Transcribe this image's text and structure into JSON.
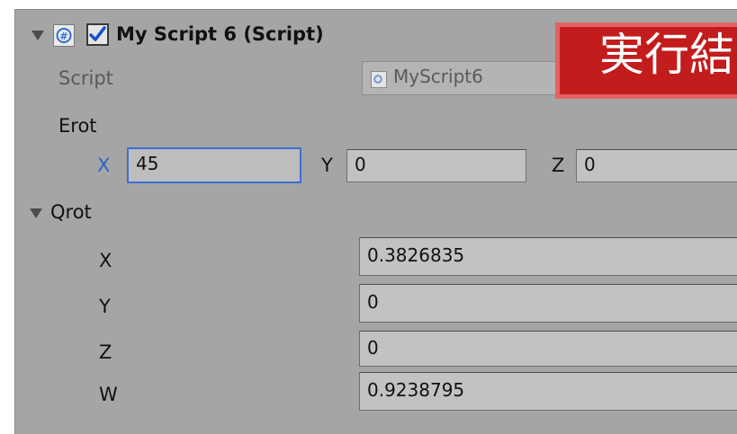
{
  "component": {
    "title": "My Script 6 (Script)",
    "enabled": true,
    "icon": "csharp-script-icon"
  },
  "script_field": {
    "label": "Script",
    "value": "MyScript6",
    "icon": "script-file-icon"
  },
  "erot": {
    "label": "Erot",
    "x_label": "X",
    "x_value": "45",
    "y_label": "Y",
    "y_value": "0",
    "z_label": "Z",
    "z_value": "0"
  },
  "qrot": {
    "label": "Qrot",
    "expanded": true,
    "x_label": "X",
    "x_value": "0.3826835",
    "y_label": "Y",
    "y_value": "0",
    "z_label": "Z",
    "z_value": "0",
    "w_label": "W",
    "w_value": "0.9238795"
  },
  "overlay": {
    "text": "実行結",
    "colors": {
      "background": "#c21c1c",
      "border": "#e26363",
      "text": "#ffffff"
    }
  },
  "colors": {
    "panel": "#a5a5a5",
    "field": "#c2c2c2",
    "focus": "#3b6fd4",
    "checkmark": "#1a52c6"
  }
}
